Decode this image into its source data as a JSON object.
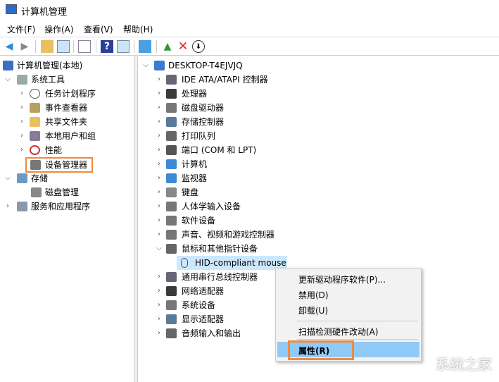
{
  "window": {
    "title": "计算机管理"
  },
  "menu": [
    "文件(F)",
    "操作(A)",
    "查看(V)",
    "帮助(H)"
  ],
  "toolbar": [
    {
      "icon": "back-arrow-icon",
      "color": "#2a8ad6"
    },
    {
      "icon": "forward-arrow-icon",
      "color": "#888888"
    },
    {
      "icon": "up-folder-icon"
    },
    {
      "icon": "show-hide-tree-icon"
    },
    {
      "icon": "properties-icon"
    },
    {
      "icon": "help-icon"
    },
    {
      "icon": "show-action-pane-icon"
    },
    {
      "icon": "scan-hardware-icon"
    },
    {
      "icon": "update-driver-icon"
    },
    {
      "icon": "uninstall-x-icon",
      "color": "#e02020"
    },
    {
      "icon": "disable-down-icon"
    }
  ],
  "left_tree": [
    {
      "label": "计算机管理(本地)",
      "icon": "computer-management-icon"
    },
    {
      "label": "系统工具",
      "icon": "tools-icon",
      "chev": "expanded"
    },
    {
      "label": "任务计划程序",
      "icon": "clock-icon",
      "chev": "collapsed"
    },
    {
      "label": "事件查看器",
      "icon": "event-viewer-icon",
      "chev": "collapsed"
    },
    {
      "label": "共享文件夹",
      "icon": "shared-folder-icon",
      "chev": "collapsed"
    },
    {
      "label": "本地用户和组",
      "icon": "users-icon",
      "chev": "collapsed"
    },
    {
      "label": "性能",
      "icon": "performance-icon",
      "chev": "collapsed"
    },
    {
      "label": "设备管理器",
      "icon": "device-manager-icon",
      "selected": true
    },
    {
      "label": "存储",
      "icon": "storage-icon",
      "chev": "expanded"
    },
    {
      "label": "磁盘管理",
      "icon": "disk-icon"
    },
    {
      "label": "服务和应用程序",
      "icon": "services-icon",
      "chev": "collapsed"
    }
  ],
  "device_tree": {
    "root": "DESKTOP-T4EJVJQ",
    "items": [
      "IDE ATA/ATAPI 控制器",
      "处理器",
      "磁盘驱动器",
      "存储控制器",
      "打印队列",
      "端口 (COM 和 LPT)",
      "计算机",
      "监视器",
      "键盘",
      "人体学输入设备",
      "软件设备",
      "声音、视频和游戏控制器",
      "鼠标和其他指针设备"
    ],
    "expanded_child": "HID-compliant mouse",
    "items_after": [
      "通用串行总线控制器",
      "网络适配器",
      "系统设备",
      "显示适配器",
      "音频输入和输出"
    ]
  },
  "context_menu": {
    "items": [
      "更新驱动程序软件(P)...",
      "禁用(D)",
      "卸载(U)",
      "扫描检测硬件改动(A)",
      "属性(R)"
    ],
    "highlighted": "属性(R)"
  },
  "accent": {
    "highlight_box": "#f08a3c",
    "selection": "#cce8ff",
    "menu_highlight": "#91c9f7"
  },
  "watermark": "系统之家"
}
